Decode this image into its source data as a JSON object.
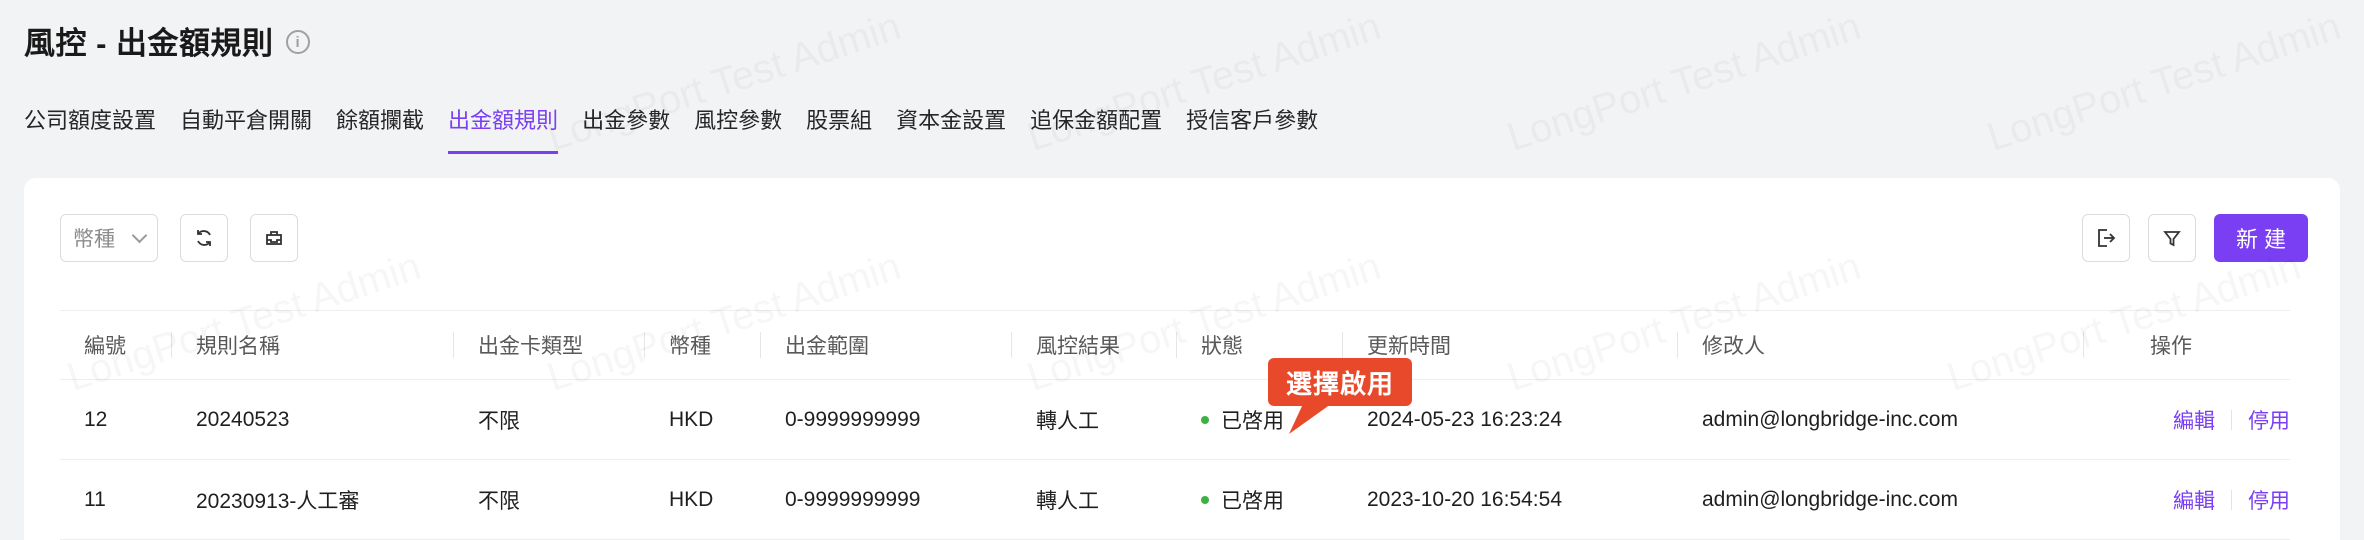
{
  "page": {
    "title": "風控 - 出金額規則",
    "info_icon": "i"
  },
  "tabs": [
    {
      "label": "公司額度設置",
      "active": false
    },
    {
      "label": "自動平倉開關",
      "active": false
    },
    {
      "label": "餘額攔截",
      "active": false
    },
    {
      "label": "出金額規則",
      "active": true
    },
    {
      "label": "出金參數",
      "active": false
    },
    {
      "label": "風控參數",
      "active": false
    },
    {
      "label": "股票組",
      "active": false
    },
    {
      "label": "資本金設置",
      "active": false
    },
    {
      "label": "追保金額配置",
      "active": false
    },
    {
      "label": "授信客戶參數",
      "active": false
    }
  ],
  "toolbar": {
    "currency_placeholder": "幣種",
    "refresh_icon": "refresh-icon",
    "import_icon": "inbox-icon",
    "export_icon": "export-icon",
    "filter_icon": "filter-icon",
    "new_label": "新建"
  },
  "table": {
    "columns": [
      "編號",
      "規則名稱",
      "出金卡類型",
      "幣種",
      "出金範圍",
      "風控結果",
      "狀態",
      "更新時間",
      "修改人",
      "操作"
    ],
    "rows": [
      {
        "id": "12",
        "name": "20240523",
        "card_type": "不限",
        "currency": "HKD",
        "range": "0-9999999999",
        "result": "轉人工",
        "status": "已啓用",
        "updated": "2024-05-23 16:23:24",
        "modifier": "admin@longbridge-inc.com",
        "edit": "編輯",
        "disable": "停用"
      },
      {
        "id": "11",
        "name": "20230913-人工審",
        "card_type": "不限",
        "currency": "HKD",
        "range": "0-9999999999",
        "result": "轉人工",
        "status": "已啓用",
        "updated": "2023-10-20 16:54:54",
        "modifier": "admin@longbridge-inc.com",
        "edit": "編輯",
        "disable": "停用"
      }
    ]
  },
  "callout": {
    "label": "選擇啟用"
  },
  "watermark": "LongPort Test Admin",
  "colors": {
    "accent": "#7a3ff2",
    "status_active": "#3cb043",
    "callout": "#e8492a"
  }
}
